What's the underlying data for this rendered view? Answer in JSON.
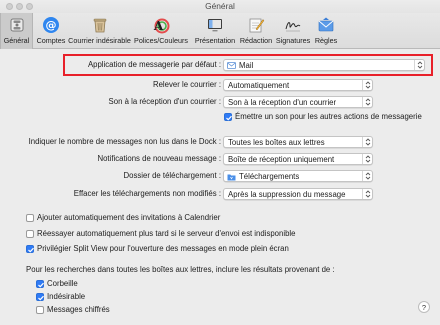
{
  "window": {
    "title": "Général"
  },
  "toolbar": {
    "items": [
      {
        "label": "Général",
        "icon": "switch-icon",
        "active": true
      },
      {
        "label": "Comptes",
        "icon": "at-icon"
      },
      {
        "label": "Courrier indésirable",
        "icon": "trash-bin-icon"
      },
      {
        "label": "Polices/Couleurs",
        "icon": "fonts-colors-icon"
      },
      {
        "label": "Présentation",
        "icon": "display-icon"
      },
      {
        "label": "Rédaction",
        "icon": "compose-icon"
      },
      {
        "label": "Signatures",
        "icon": "signature-icon"
      },
      {
        "label": "Règles",
        "icon": "rules-icon"
      }
    ]
  },
  "settings": {
    "default_mail_app": {
      "label": "Application de messagerie par défaut :",
      "value": "Mail",
      "icon": "mail-app-icon"
    },
    "check_mail": {
      "label": "Relever le courrier :",
      "value": "Automatiquement"
    },
    "new_mail_sound": {
      "label": "Son à la réception d'un courrier :",
      "value": "Son à la réception d'un courrier"
    },
    "play_sounds": {
      "label": "Émettre un son pour les autres actions de messagerie",
      "checked": true
    },
    "dock_unread": {
      "label": "Indiquer le nombre de messages non lus dans le Dock :",
      "value": "Toutes les boîtes aux lettres"
    },
    "notifications": {
      "label": "Notifications de nouveau message :",
      "value": "Boîte de réception uniquement"
    },
    "downloads_folder": {
      "label": "Dossier de téléchargement :",
      "value": "Téléchargements",
      "icon": "folder-icon"
    },
    "remove_downloads": {
      "label": "Effacer les téléchargements non modifiés :",
      "value": "Après la suppression du message"
    }
  },
  "options": [
    {
      "label": "Ajouter automatiquement des invitations à Calendrier",
      "checked": false
    },
    {
      "label": "Réessayer automatiquement plus tard si le serveur d'envoi est indisponible",
      "checked": false
    },
    {
      "label": "Privilégier Split View pour l'ouverture des messages en mode plein écran",
      "checked": true
    }
  ],
  "search": {
    "intro": "Pour les recherches dans toutes les boîtes aux lettres, inclure les résultats provenant de :",
    "items": [
      {
        "label": "Corbeille",
        "checked": true
      },
      {
        "label": "Indésirable",
        "checked": true
      },
      {
        "label": "Messages chiffrés",
        "checked": false
      }
    ]
  },
  "help": {
    "label": "?"
  },
  "colors": {
    "highlight": "#e8202a",
    "checkbox_on": "#2f7bf6",
    "folder": "#4a8fe8"
  }
}
